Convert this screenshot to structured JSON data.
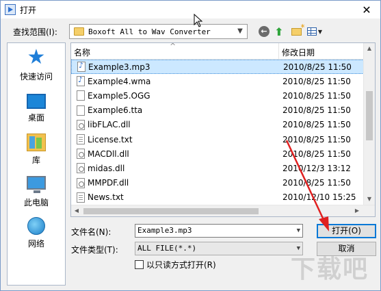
{
  "window": {
    "title": "打开",
    "close_glyph": "✕"
  },
  "lookin": {
    "label": "查找范围(I):",
    "value": "Boxoft All to Wav Converter"
  },
  "places": [
    {
      "label": "快速访问",
      "icon": "star-icon"
    },
    {
      "label": "桌面",
      "icon": "desktop-icon"
    },
    {
      "label": "库",
      "icon": "library-icon"
    },
    {
      "label": "此电脑",
      "icon": "computer-icon"
    },
    {
      "label": "网络",
      "icon": "network-icon"
    }
  ],
  "filelist": {
    "columns": {
      "name": "名称",
      "date": "修改日期"
    },
    "rows": [
      {
        "name": "Example3.mp3",
        "date": "2010/8/25 11:50",
        "type": "audio",
        "selected": true
      },
      {
        "name": "Example4.wma",
        "date": "2010/8/25 11:50",
        "type": "audio"
      },
      {
        "name": "Example5.OGG",
        "date": "2010/8/25 11:50",
        "type": "blank"
      },
      {
        "name": "Example6.tta",
        "date": "2010/8/25 11:50",
        "type": "blank"
      },
      {
        "name": "libFLAC.dll",
        "date": "2010/8/25 11:50",
        "type": "dll"
      },
      {
        "name": "License.txt",
        "date": "2010/8/25 11:50",
        "type": "txt"
      },
      {
        "name": "MACDll.dll",
        "date": "2010/8/25 11:50",
        "type": "dll"
      },
      {
        "name": "midas.dll",
        "date": "2010/12/3 13:12",
        "type": "dll"
      },
      {
        "name": "MMPDF.dll",
        "date": "2010/8/25 11:50",
        "type": "dll"
      },
      {
        "name": "News.txt",
        "date": "2010/12/10 15:25",
        "type": "txt"
      }
    ]
  },
  "form": {
    "filename_label": "文件名(N):",
    "filename_value": "Example3.mp3",
    "filetype_label": "文件类型(T):",
    "filetype_value": "ALL FILE(*.*)",
    "readonly_label": "以只读方式打开(R)",
    "readonly_checked": false,
    "open_label": "打开(O)",
    "cancel_label": "取消"
  },
  "colors": {
    "selection": "#cce8ff",
    "annotation_arrow": "#e02020"
  },
  "watermark": "下载吧"
}
